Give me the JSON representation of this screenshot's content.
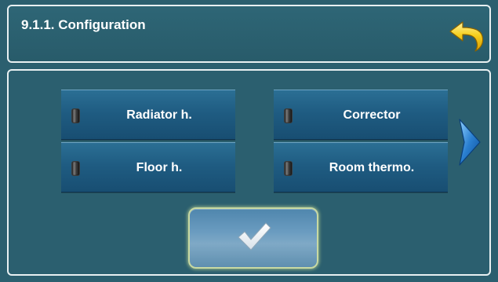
{
  "header": {
    "title": "9.1.1. Configuration",
    "back_icon": "back-arrow-icon"
  },
  "options": [
    {
      "label": "Radiator h.",
      "indicator": "off"
    },
    {
      "label": "Corrector",
      "indicator": "off"
    },
    {
      "label": "Floor h.",
      "indicator": "off"
    },
    {
      "label": "Room thermo.",
      "indicator": "off"
    }
  ],
  "navigation": {
    "next_icon": "chevron-right-icon"
  },
  "confirm": {
    "icon": "checkmark-icon"
  },
  "colors": {
    "background": "#2b5f6f",
    "button": "#1f5c82",
    "accent_yellow": "#f4c61a",
    "next_blue": "#2a7fd0"
  }
}
